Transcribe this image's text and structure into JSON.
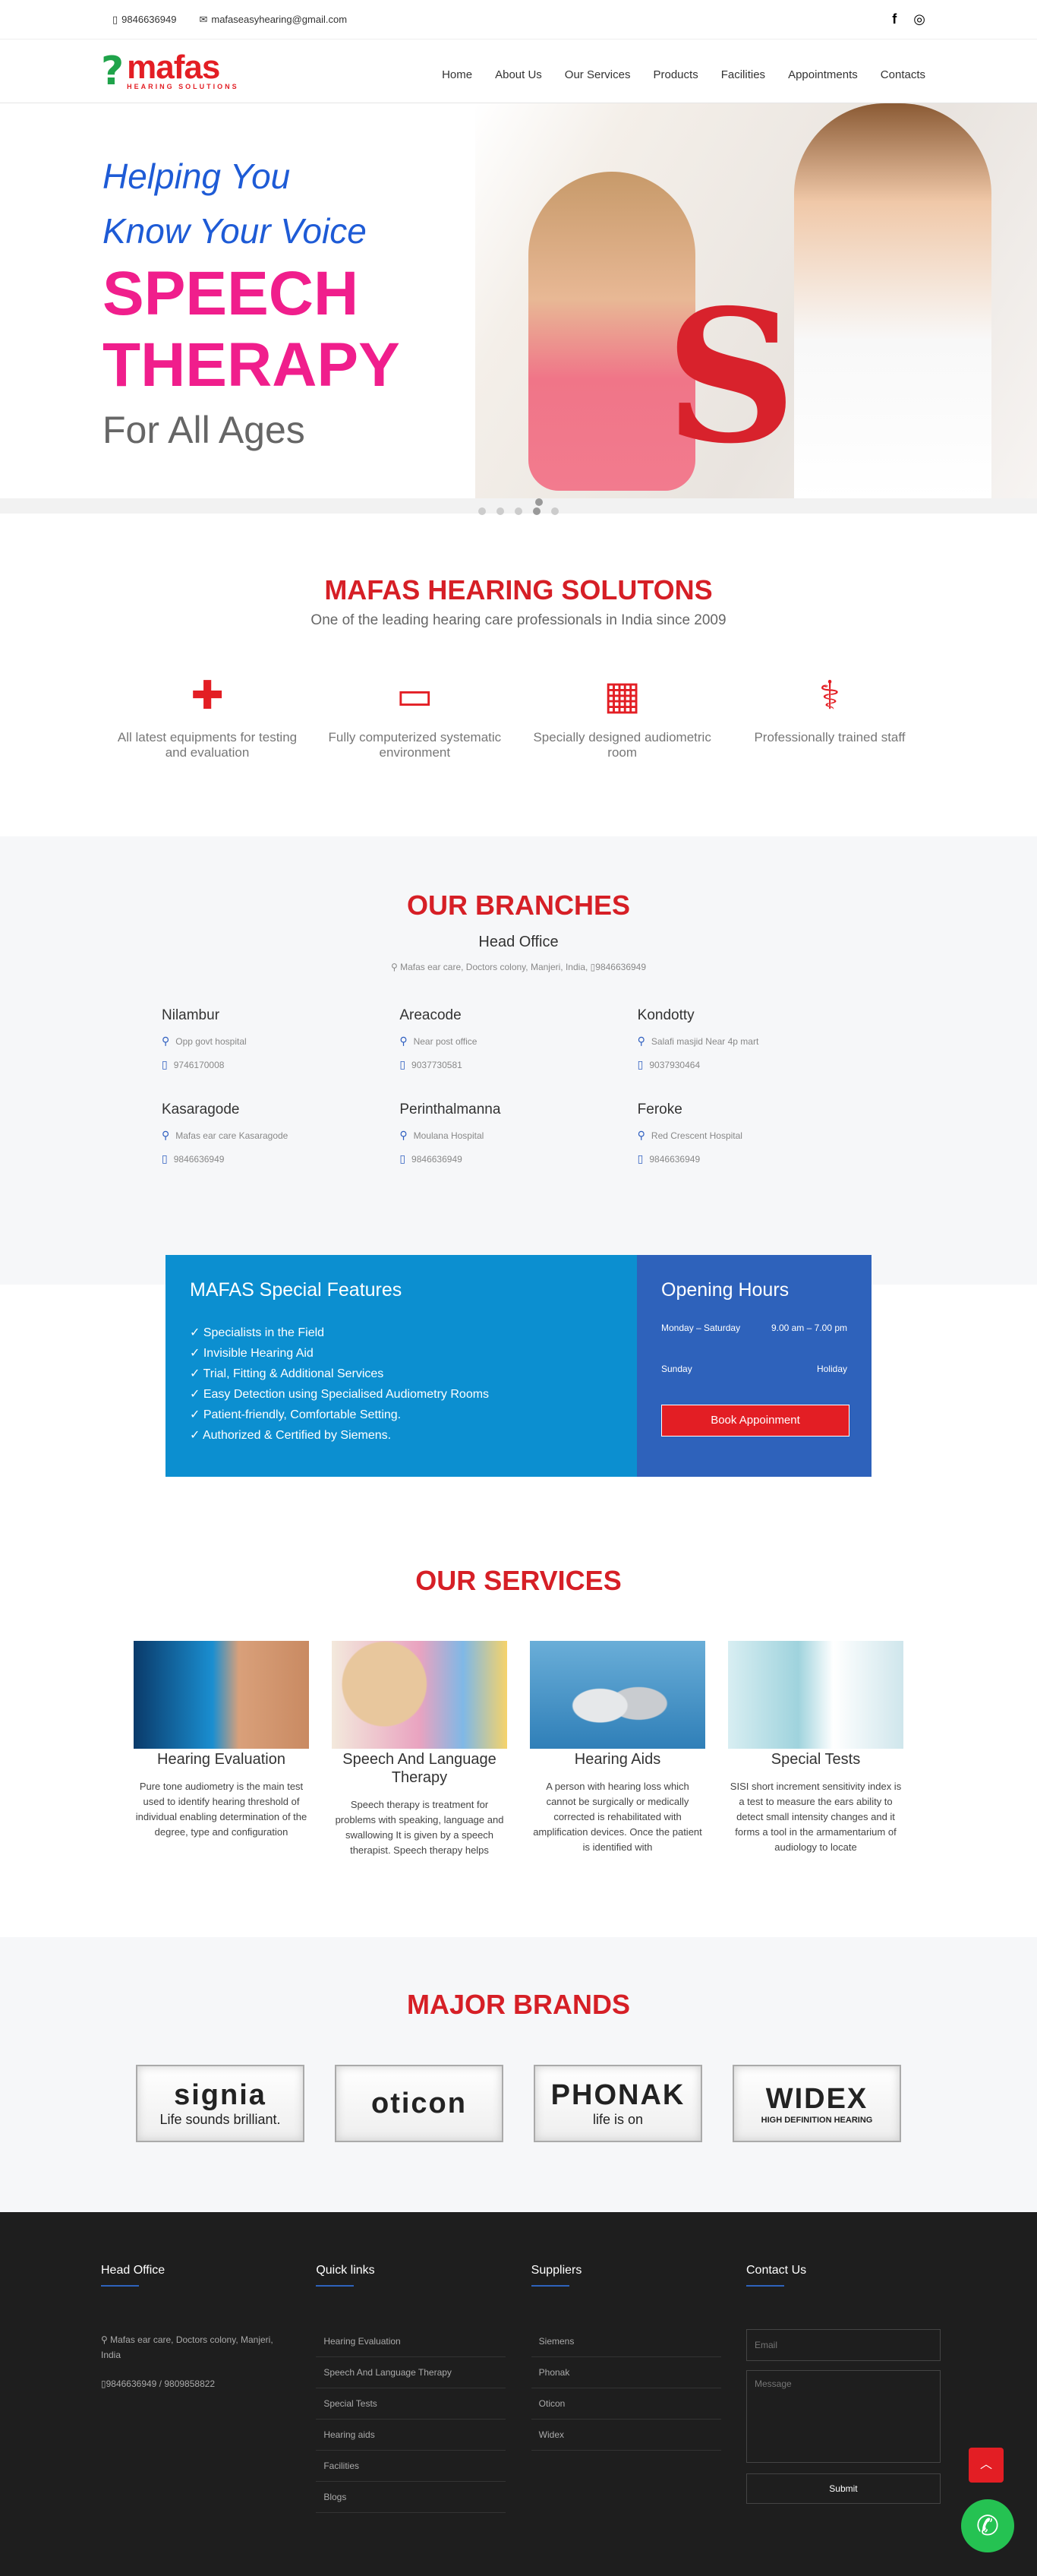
{
  "topbar": {
    "phone": "9846636949",
    "email": "mafaseasyhearing@gmail.com",
    "social": [
      {
        "icon": "facebook-icon",
        "glyph": "f"
      },
      {
        "icon": "instagram-icon",
        "glyph": "◎"
      }
    ]
  },
  "logo": {
    "mark": "?",
    "name": "mafas",
    "sub": "HEARING SOLUTIONS"
  },
  "menu": [
    "Home",
    "About Us",
    "Our Services",
    "Products",
    "Facilities",
    "Appointments",
    "Contacts"
  ],
  "hero": {
    "line1": "Helping You",
    "line2": "Know Your Voice",
    "line3": "SPEECH",
    "line4": "THERAPY",
    "line5": "For All Ages",
    "image_letter": "S"
  },
  "about": {
    "title": "MAFAS HEARING SOLUTONS",
    "tagline": "One of the leading hearing care professionals in India since 2009",
    "features": [
      {
        "icon": "medical-kit-icon",
        "glyph": "✚",
        "text": "All latest equipments for testing and evaluation"
      },
      {
        "icon": "monitor-icon",
        "glyph": "▭",
        "text": "Fully computerized systematic environment"
      },
      {
        "icon": "hospital-icon",
        "glyph": "▦",
        "text": "Specially designed audiometric room"
      },
      {
        "icon": "doctor-icon",
        "glyph": "⚕",
        "text": "Professionally trained staff"
      }
    ]
  },
  "branches": {
    "title": "OUR BRANCHES",
    "head_office": "Head Office",
    "head_address": "Mafas ear care, Doctors colony, Manjeri, India",
    "head_phone": "9846636949",
    "list": [
      {
        "name": "Nilambur",
        "address": "Opp govt hospital",
        "phone": "9746170008"
      },
      {
        "name": "Areacode",
        "address": "Near post office",
        "phone": "9037730581"
      },
      {
        "name": "Kondotty",
        "address": "Salafi masjid Near 4p mart",
        "phone": "9037930464"
      },
      {
        "name": "Kasaragode",
        "address": "Mafas ear care Kasaragode",
        "phone": "9846636949"
      },
      {
        "name": "Perinthalmanna",
        "address": "Moulana Hospital",
        "phone": "9846636949"
      },
      {
        "name": "Feroke",
        "address": "Red Crescent Hospital",
        "phone": "9846636949"
      }
    ]
  },
  "special": {
    "title": "MAFAS Special Features",
    "items": [
      "✓ Specialists in the Field",
      "✓ Invisible Hearing Aid",
      "✓ Trial, Fitting & Additional Services",
      "✓ Easy Detection using Specialised Audiometry Rooms",
      "✓ Patient-friendly, Comfortable Setting.",
      "✓ Authorized & Certified by Siemens."
    ],
    "hours_title": "Opening Hours",
    "weekday_label": "Monday – Saturday",
    "weekday_hours": "9.00 am – 7.00 pm",
    "sunday_label": "Sunday",
    "sunday_hours": "Holiday",
    "book_label": "Book Appoinment"
  },
  "services": {
    "title": "OUR SERVICES",
    "items": [
      {
        "name": "Hearing Evaluation",
        "desc": "Pure tone audiometry is the main test used to identify hearing threshold of individual enabling determination of the degree, type and configuration"
      },
      {
        "name": "Speech And Language Therapy",
        "desc": "Speech therapy is treatment for problems with speaking, language and swallowing It is given by a speech therapist. Speech therapy helps"
      },
      {
        "name": "Hearing Aids",
        "desc": "A person with hearing loss which cannot be surgically or medically corrected is rehabilitated with amplification devices. Once the patient is identified with"
      },
      {
        "name": "Special Tests",
        "desc": "SISI short increment sensitivity index is a test to measure the ears ability to detect small intensity changes and it forms a tool in the armamentarium of audiology to locate"
      }
    ]
  },
  "brands": {
    "title": "MAJOR BRANDS",
    "list": [
      {
        "word": "signia",
        "sub": "Life sounds brilliant."
      },
      {
        "word": "oticon",
        "sub": ""
      },
      {
        "word": "PHONAK",
        "sub": "life is on"
      },
      {
        "word": "WIDEX",
        "sub": "HIGH DEFINITION HEARING"
      }
    ]
  },
  "footer": {
    "head_office_title": "Head Office",
    "address": "Mafas ear care, Doctors colony, Manjeri, India",
    "phones": "9846636949 / 9809858822",
    "quick_title": "Quick links",
    "quick_links": [
      "Hearing Evaluation",
      "Speech And Language Therapy",
      "Special Tests",
      "Hearing aids",
      "Facilities",
      "Blogs"
    ],
    "suppliers_title": "Suppliers",
    "suppliers": [
      "Siemens",
      "Phonak",
      "Oticon",
      "Widex"
    ],
    "contact_title": "Contact Us",
    "email_placeholder": "Email",
    "message_placeholder": "Message",
    "submit_label": "Submit"
  },
  "colors": {
    "brand_red": "#e31e24",
    "hero_blue": "#1e5bd6",
    "hero_pink": "#f01e8c",
    "features_blue": "#0c8fd0",
    "hours_blue": "#2e62bb",
    "whatsapp_green": "#25c252"
  }
}
